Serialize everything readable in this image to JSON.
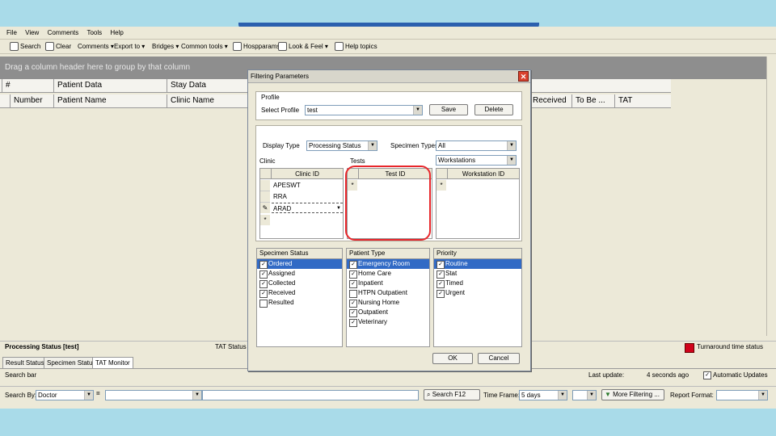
{
  "menu": [
    "File",
    "View",
    "Comments",
    "Tools",
    "Help"
  ],
  "toolbar": {
    "search": "Search",
    "clear": "Clear",
    "comments": "Comments ▾",
    "export": "Export to ▾",
    "bridges": "Bridges ▾",
    "common_tools": "Common tools ▾",
    "hospparams": "Hospparams",
    "look_feel": "Look & Feel ▾",
    "help_topics": "Help topics"
  },
  "group_hint": "Drag a column header here to group by that column",
  "grid": {
    "header_row1": [
      "#",
      "Patient Data",
      "Stay Data"
    ],
    "header_row2": [
      "Number",
      "Patient Name",
      "Clinic Name"
    ],
    "header_right": [
      "Received",
      "To Be ...",
      "TAT"
    ]
  },
  "status": {
    "left": "Processing Status [test]",
    "tat": "TAT Status",
    "right": "Turnaround time status"
  },
  "tabs": [
    "Result Status",
    "Specimen Status",
    "TAT Monitor"
  ],
  "search_row": {
    "left": "Search bar",
    "last_update": "Last update:",
    "ago": "4 seconds ago",
    "auto": "Automatic Updates"
  },
  "bottom": {
    "search_by_label": "Search By:",
    "search_by_value": "Doctor",
    "search_btn": "Search F12",
    "time_frame_label": "Time Frame:",
    "time_frame_value": "5 days",
    "more_filtering": "More Filtering ...",
    "report_format": "Report Format:"
  },
  "dialog": {
    "title": "Filtering Parameters",
    "profile_group": "Profile",
    "select_profile_label": "Select Profile",
    "select_profile_value": "test",
    "save": "Save",
    "delete": "Delete",
    "display_type_label": "Display Type",
    "display_type_value": "Processing Status",
    "specimen_types_label": "Specimen Types",
    "specimen_types_value": "All",
    "clinic_label": "Clinic",
    "tests_label": "Tests",
    "tests_value": "Workstations",
    "clinic_grid_header": "Clinic ID",
    "clinic_rows": [
      "APESWT",
      "RRA",
      "ARAD"
    ],
    "test_grid_header": "Test ID",
    "ws_grid_header": "Workstation ID",
    "specimen_status": {
      "title": "Specimen Status",
      "items": [
        "Ordered",
        "Assigned",
        "Collected",
        "Received",
        "Resulted"
      ],
      "checked": [
        true,
        true,
        true,
        true,
        false
      ]
    },
    "patient_type": {
      "title": "Patient Type",
      "items": [
        "Emergency Room",
        "Home Care",
        "Inpatient",
        "HTPN Outpatient",
        "Nursing Home",
        "Outpatient",
        "Veterinary"
      ],
      "checked": [
        true,
        true,
        true,
        false,
        true,
        true,
        true
      ]
    },
    "priority": {
      "title": "Priority",
      "items": [
        "Routine",
        "Stat",
        "Timed",
        "Urgent"
      ],
      "checked": [
        true,
        true,
        true,
        true
      ]
    },
    "ok": "OK",
    "cancel": "Cancel"
  }
}
